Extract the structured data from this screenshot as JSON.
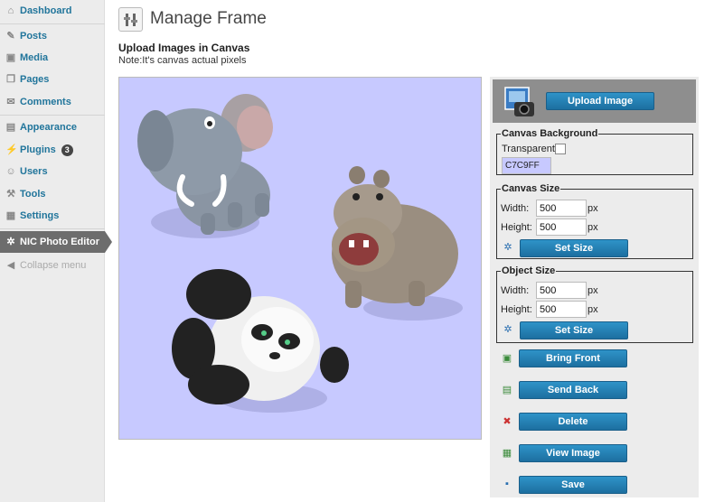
{
  "sidebar": {
    "items": [
      {
        "label": "Dashboard",
        "icon": "dashboard-icon",
        "glyph": "⌂"
      },
      {
        "label": "Posts",
        "icon": "pin-icon",
        "glyph": "✎"
      },
      {
        "label": "Media",
        "icon": "media-icon",
        "glyph": "▣"
      },
      {
        "label": "Pages",
        "icon": "pages-icon",
        "glyph": "❐"
      },
      {
        "label": "Comments",
        "icon": "comments-icon",
        "glyph": "✉"
      },
      {
        "label": "Appearance",
        "icon": "appearance-icon",
        "glyph": "▤"
      },
      {
        "label": "Plugins",
        "icon": "plugins-icon",
        "glyph": "⚡",
        "badge": "3"
      },
      {
        "label": "Users",
        "icon": "users-icon",
        "glyph": "☺"
      },
      {
        "label": "Tools",
        "icon": "tools-icon",
        "glyph": "⚒"
      },
      {
        "label": "Settings",
        "icon": "settings-icon",
        "glyph": "▦"
      },
      {
        "label": "NIC Photo Editor",
        "icon": "gear-icon",
        "glyph": "✲"
      },
      {
        "label": "Collapse menu",
        "icon": "collapse-icon",
        "glyph": "◀"
      }
    ]
  },
  "page": {
    "title": "Manage Frame",
    "section_title": "Upload Images in Canvas",
    "note": "Note:It's canvas actual pixels"
  },
  "canvas": {
    "background": "#C7C9FF",
    "objects": [
      "elephant",
      "hippo",
      "panda"
    ]
  },
  "panel": {
    "upload_button": "Upload Image",
    "canvas_background": {
      "legend": "Canvas Background",
      "transparent_label": "Transparent",
      "transparent_checked": false,
      "color_value": "C7C9FF"
    },
    "canvas_size": {
      "legend": "Canvas Size",
      "width_label": "Width:",
      "width_value": "500",
      "height_label": "Height:",
      "height_value": "500",
      "unit": "px",
      "set_button": "Set Size"
    },
    "object_size": {
      "legend": "Object Size",
      "width_label": "Width:",
      "width_value": "500",
      "height_label": "Height:",
      "height_value": "500",
      "unit": "px",
      "set_button": "Set Size"
    },
    "actions": {
      "bring_front": "Bring Front",
      "send_back": "Send Back",
      "delete": "Delete",
      "view_image": "View Image",
      "save": "Save"
    }
  },
  "colors": {
    "accent": "#21759b",
    "button": "#2281b4",
    "canvas_bg": "#C7C9FF",
    "current_menu": "#6d6d6d"
  }
}
